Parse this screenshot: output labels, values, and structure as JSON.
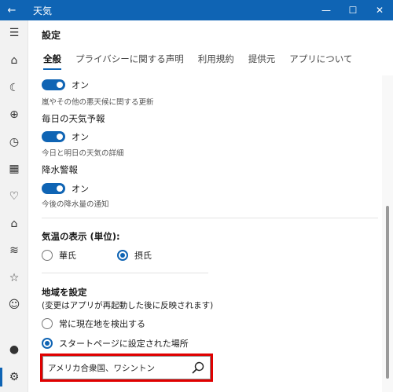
{
  "window": {
    "title": "天気"
  },
  "header": {
    "page_title": "設定"
  },
  "tabs": [
    {
      "label": "全般"
    },
    {
      "label": "プライバシーに関する声明"
    },
    {
      "label": "利用規約"
    },
    {
      "label": "提供元"
    },
    {
      "label": "アプリについて"
    }
  ],
  "settings": {
    "severe_weather": {
      "state": "オン",
      "description": "嵐やその他の悪天候に関する更新"
    },
    "daily_forecast": {
      "label": "毎日の天気予報",
      "state": "オン",
      "description": "今日と明日の天気の詳細"
    },
    "precip_alert": {
      "label": "降水警報",
      "state": "オン",
      "description": "今後の降水量の通知"
    },
    "temperature": {
      "label": "気温の表示 (単位):",
      "options": [
        {
          "label": "華氏",
          "selected": false
        },
        {
          "label": "摂氏",
          "selected": true
        }
      ]
    },
    "region": {
      "label": "地域を設定",
      "note": "(変更はアプリが再起動した後に反映されます)",
      "options": [
        {
          "label": "常に現在地を検出する",
          "selected": false
        },
        {
          "label": "スタートページに設定された場所",
          "selected": true
        }
      ],
      "location_value": "アメリカ合衆国、ワシントン"
    }
  },
  "colors": {
    "accent": "#0f64b4",
    "highlight": "#e00000"
  },
  "rail_icons": [
    "menu-icon",
    "home-icon",
    "forecast-icon",
    "globe-icon",
    "clock-icon",
    "calendar-icon",
    "heart-icon",
    "map-icon",
    "chart-icon",
    "star-list-icon",
    "smiley-icon",
    "account-icon",
    "settings-icon"
  ]
}
